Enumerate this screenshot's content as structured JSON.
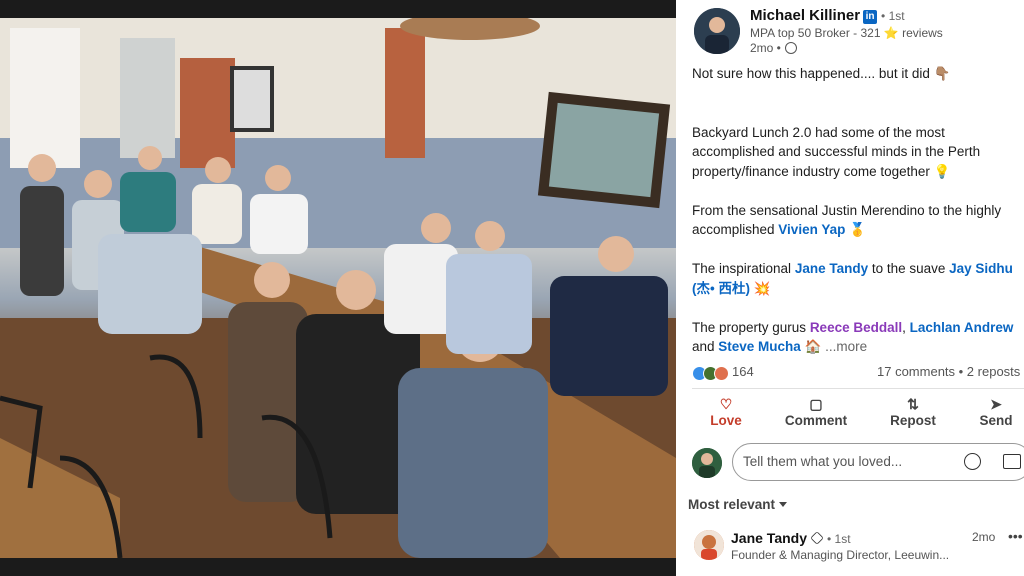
{
  "post": {
    "author": {
      "name": "Michael Killiner",
      "degree": "• 1st",
      "headline": "MPA top 50 Broker - 321 ⭐ reviews",
      "time": "2mo •"
    },
    "body": {
      "line1": "Not sure how this happened.... but it did 👇🏽",
      "p2_l1": "Backyard Lunch 2.0 had some of the most",
      "p2_l2": "accomplished and successful minds in the Perth",
      "p2_l3": "property/finance industry come together 💡",
      "p3_l1": "From the sensational Justin Merendino to the highly",
      "p3_l2_pre": "accomplished ",
      "p3_mention": "Vivien Yap",
      "p3_emoji": " 🥇",
      "p4_pre": "The inspirational ",
      "p4_m1": "Jane Tandy",
      "p4_mid": " to the suave ",
      "p4_m2": "Jay Sidhu",
      "p4_m2b": "(杰• 西杜)",
      "p4_emoji": " 💥",
      "p5_pre": "The property gurus ",
      "p5_m1": "Reece Beddall",
      "p5_sep": ", ",
      "p5_m2": "Lachlan Andrew",
      "p5_and": " and ",
      "p5_m3": "Steve Mucha",
      "p5_emoji": " 🏠",
      "more": " ...more"
    },
    "reactions": {
      "count": "164",
      "stats": "17 comments • 2 reposts"
    },
    "actions": {
      "love": "Love",
      "comment": "Comment",
      "repost": "Repost",
      "send": "Send"
    },
    "comment_placeholder": "Tell them what you loved...",
    "sort_label": "Most relevant",
    "comments": [
      {
        "name": "Jane Tandy",
        "degree": "• 1st",
        "headline": "Founder & Managing Director, Leeuwin...",
        "time": "2mo",
        "menu": "•••"
      }
    ]
  },
  "colors": {
    "link_blue": "#0a66c2",
    "mention_purple": "#8a3ab9",
    "love_red": "#c43d2b"
  }
}
